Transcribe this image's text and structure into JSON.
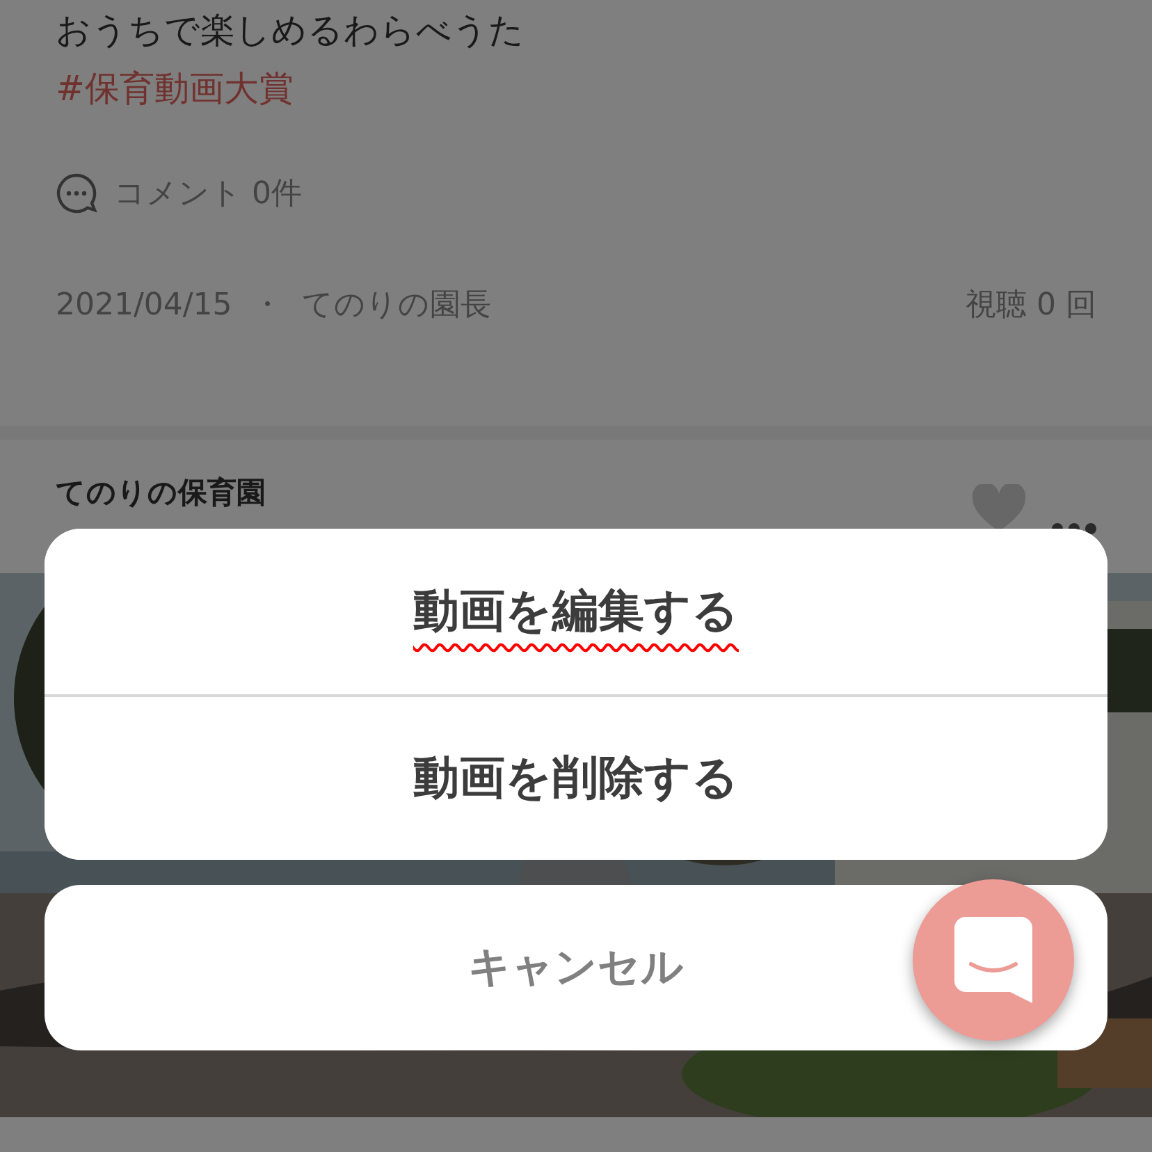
{
  "post": {
    "title": "おうちで楽しめるわらべうた",
    "hashtag": "#保育動画大賞",
    "comments": "コメント 0件",
    "date": "2021/04/15",
    "separator": "・",
    "author": "てのりの園長",
    "views": "視聴 0 回"
  },
  "next_post": {
    "name": "てのりの保育園",
    "liked": false
  },
  "action_sheet": {
    "actions": [
      {
        "label": "動画を編集する",
        "misspelled": true
      },
      {
        "label": "動画を削除する",
        "misspelled": false
      }
    ],
    "cancel": "キャンセル"
  }
}
